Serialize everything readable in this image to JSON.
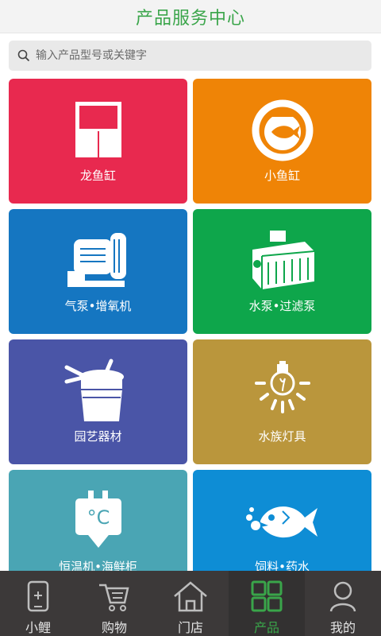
{
  "header": {
    "title": "产品服务中心"
  },
  "search": {
    "placeholder": "输入产品型号或关键字"
  },
  "categories": [
    {
      "label": "龙鱼缸",
      "color": "#e8294f",
      "icon": "aquarium-cabinet-icon"
    },
    {
      "label": "小鱼缸",
      "color": "#ef8406",
      "icon": "fishbowl-icon"
    },
    {
      "label": "气泵•增氧机",
      "color": "#1576c1",
      "icon": "air-pump-icon"
    },
    {
      "label": "水泵•过滤泵",
      "color": "#0ea64b",
      "icon": "water-pump-icon"
    },
    {
      "label": "园艺器材",
      "color": "#4a55a7",
      "icon": "garden-filter-icon"
    },
    {
      "label": "水族灯具",
      "color": "#ba963c",
      "icon": "light-bulb-icon"
    },
    {
      "label": "恒温机•海鲜柜",
      "color": "#4aa5b4",
      "icon": "thermostat-icon"
    },
    {
      "label": "饲料•药水",
      "color": "#0e8dd5",
      "icon": "fish-food-icon"
    }
  ],
  "tabbar": {
    "items": [
      {
        "label": "小鲤",
        "icon": "phone-icon",
        "active": false
      },
      {
        "label": "购物",
        "icon": "shopping-cart-icon",
        "active": false
      },
      {
        "label": "门店",
        "icon": "store-home-icon",
        "active": false
      },
      {
        "label": "产品",
        "icon": "grid-icon",
        "active": true
      },
      {
        "label": "我的",
        "icon": "user-icon",
        "active": false
      }
    ]
  },
  "colors": {
    "accent": "#3aa54a",
    "tabbar_bg": "#3c3939"
  }
}
